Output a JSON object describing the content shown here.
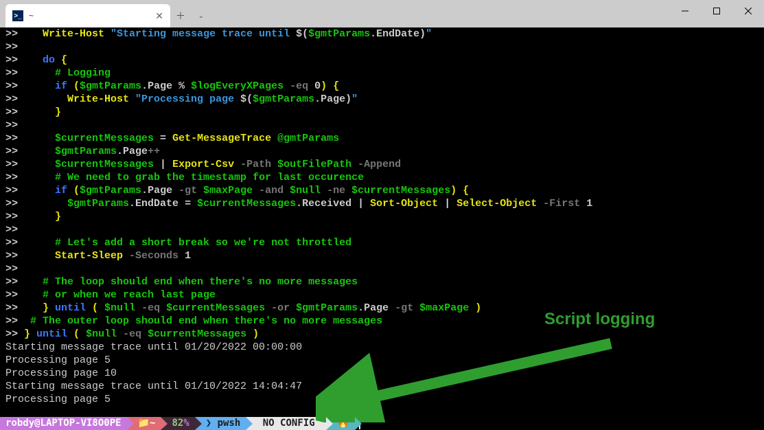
{
  "window": {
    "tab_title": "~",
    "tab_icon_text": ">_"
  },
  "annotation": {
    "text": "Script logging"
  },
  "lines": [
    {
      "p": ">>    ",
      "seg": [
        [
          "Write-Host ",
          "y"
        ],
        [
          "\"Starting message trace until ",
          "c"
        ],
        [
          "$(",
          "w"
        ],
        [
          "$gmtParams",
          "g"
        ],
        [
          ".",
          "w"
        ],
        [
          "EndDate",
          "w"
        ],
        [
          ")",
          "w"
        ],
        [
          "\"",
          "c"
        ]
      ]
    },
    {
      "p": ">>",
      "seg": []
    },
    {
      "p": ">>    ",
      "seg": [
        [
          "do ",
          "bl"
        ],
        [
          "{",
          "y"
        ]
      ]
    },
    {
      "p": ">>      ",
      "seg": [
        [
          "# Logging",
          "g"
        ]
      ]
    },
    {
      "p": ">>      ",
      "seg": [
        [
          "if ",
          "bl"
        ],
        [
          "(",
          "y"
        ],
        [
          "$gmtParams",
          "g"
        ],
        [
          ".",
          "w"
        ],
        [
          "Page ",
          "w"
        ],
        [
          "% ",
          "w"
        ],
        [
          "$logEveryXPages ",
          "g"
        ],
        [
          "-eq ",
          "gray"
        ],
        [
          "0",
          "w"
        ],
        [
          ") ",
          "y"
        ],
        [
          "{",
          "y"
        ]
      ]
    },
    {
      "p": ">>        ",
      "seg": [
        [
          "Write-Host ",
          "y"
        ],
        [
          "\"Processing page ",
          "c"
        ],
        [
          "$(",
          "w"
        ],
        [
          "$gmtParams",
          "g"
        ],
        [
          ".",
          "w"
        ],
        [
          "Page",
          "w"
        ],
        [
          ")",
          "w"
        ],
        [
          "\"",
          "c"
        ]
      ]
    },
    {
      "p": ">>      ",
      "seg": [
        [
          "}",
          "y"
        ]
      ]
    },
    {
      "p": ">>",
      "seg": []
    },
    {
      "p": ">>      ",
      "seg": [
        [
          "$currentMessages ",
          "g"
        ],
        [
          "= ",
          "w"
        ],
        [
          "Get-MessageTrace ",
          "y"
        ],
        [
          "@gmtParams",
          "g"
        ]
      ]
    },
    {
      "p": ">>      ",
      "seg": [
        [
          "$gmtParams",
          "g"
        ],
        [
          ".",
          "w"
        ],
        [
          "Page",
          "w"
        ],
        [
          "++",
          "gray"
        ]
      ]
    },
    {
      "p": ">>      ",
      "seg": [
        [
          "$currentMessages ",
          "g"
        ],
        [
          "| ",
          "w"
        ],
        [
          "Export-Csv ",
          "y"
        ],
        [
          "-Path ",
          "gray"
        ],
        [
          "$outFilePath ",
          "g"
        ],
        [
          "-Append",
          "gray"
        ]
      ]
    },
    {
      "p": ">>      ",
      "seg": [
        [
          "# We need to grab the timestamp for last occurence",
          "g"
        ]
      ]
    },
    {
      "p": ">>      ",
      "seg": [
        [
          "if ",
          "bl"
        ],
        [
          "(",
          "y"
        ],
        [
          "$gmtParams",
          "g"
        ],
        [
          ".",
          "w"
        ],
        [
          "Page ",
          "w"
        ],
        [
          "-gt ",
          "gray"
        ],
        [
          "$maxPage ",
          "g"
        ],
        [
          "-and ",
          "gray"
        ],
        [
          "$null ",
          "g"
        ],
        [
          "-ne ",
          "gray"
        ],
        [
          "$currentMessages",
          "g"
        ],
        [
          ") ",
          "y"
        ],
        [
          "{",
          "y"
        ]
      ]
    },
    {
      "p": ">>        ",
      "seg": [
        [
          "$gmtParams",
          "g"
        ],
        [
          ".",
          "w"
        ],
        [
          "EndDate ",
          "w"
        ],
        [
          "= ",
          "w"
        ],
        [
          "$currentMessages",
          "g"
        ],
        [
          ".",
          "w"
        ],
        [
          "Received ",
          "w"
        ],
        [
          "| ",
          "w"
        ],
        [
          "Sort-Object ",
          "y"
        ],
        [
          "| ",
          "w"
        ],
        [
          "Select-Object ",
          "y"
        ],
        [
          "-First ",
          "gray"
        ],
        [
          "1",
          "w"
        ]
      ]
    },
    {
      "p": ">>      ",
      "seg": [
        [
          "}",
          "y"
        ]
      ]
    },
    {
      "p": ">>",
      "seg": []
    },
    {
      "p": ">>      ",
      "seg": [
        [
          "# Let's add a short break so we're not throttled",
          "g"
        ]
      ]
    },
    {
      "p": ">>      ",
      "seg": [
        [
          "Start-Sleep ",
          "y"
        ],
        [
          "-Seconds ",
          "gray"
        ],
        [
          "1",
          "w"
        ]
      ]
    },
    {
      "p": ">>",
      "seg": []
    },
    {
      "p": ">>    ",
      "seg": [
        [
          "# The loop should end when there's no more messages",
          "g"
        ]
      ]
    },
    {
      "p": ">>    ",
      "seg": [
        [
          "# or when we reach last page",
          "g"
        ]
      ]
    },
    {
      "p": ">>    ",
      "seg": [
        [
          "} ",
          "y"
        ],
        [
          "until ",
          "bl"
        ],
        [
          "( ",
          "y"
        ],
        [
          "$null ",
          "g"
        ],
        [
          "-eq ",
          "gray"
        ],
        [
          "$currentMessages ",
          "g"
        ],
        [
          "-or ",
          "gray"
        ],
        [
          "$gmtParams",
          "g"
        ],
        [
          ".",
          "w"
        ],
        [
          "Page ",
          "w"
        ],
        [
          "-gt ",
          "gray"
        ],
        [
          "$maxPage ",
          "g"
        ],
        [
          ")",
          "y"
        ]
      ]
    },
    {
      "p": ">>  ",
      "seg": [
        [
          "# The outer loop should end when there's no more messages",
          "g"
        ]
      ]
    },
    {
      "p": ">> ",
      "seg": [
        [
          "} ",
          "y"
        ],
        [
          "until ",
          "bl"
        ],
        [
          "( ",
          "y"
        ],
        [
          "$null ",
          "g"
        ],
        [
          "-eq ",
          "gray"
        ],
        [
          "$currentMessages ",
          "g"
        ],
        [
          ")",
          "y"
        ]
      ]
    }
  ],
  "output": [
    "Starting message trace until 01/20/2022 00:00:00",
    "Processing page 5",
    "Processing page 10",
    "Starting message trace until 01/10/2022 14:04:47",
    "Processing page 5"
  ],
  "status": {
    "user": "robdy@LAPTOP-VI8O0PE",
    "folder_icon": "📁",
    "path": "~",
    "pct": "82",
    "pct_sym": "%",
    "shell_icon": "❯",
    "shell": " pwsh",
    "config": " NO CONFIG ",
    "fire": "🔥"
  }
}
